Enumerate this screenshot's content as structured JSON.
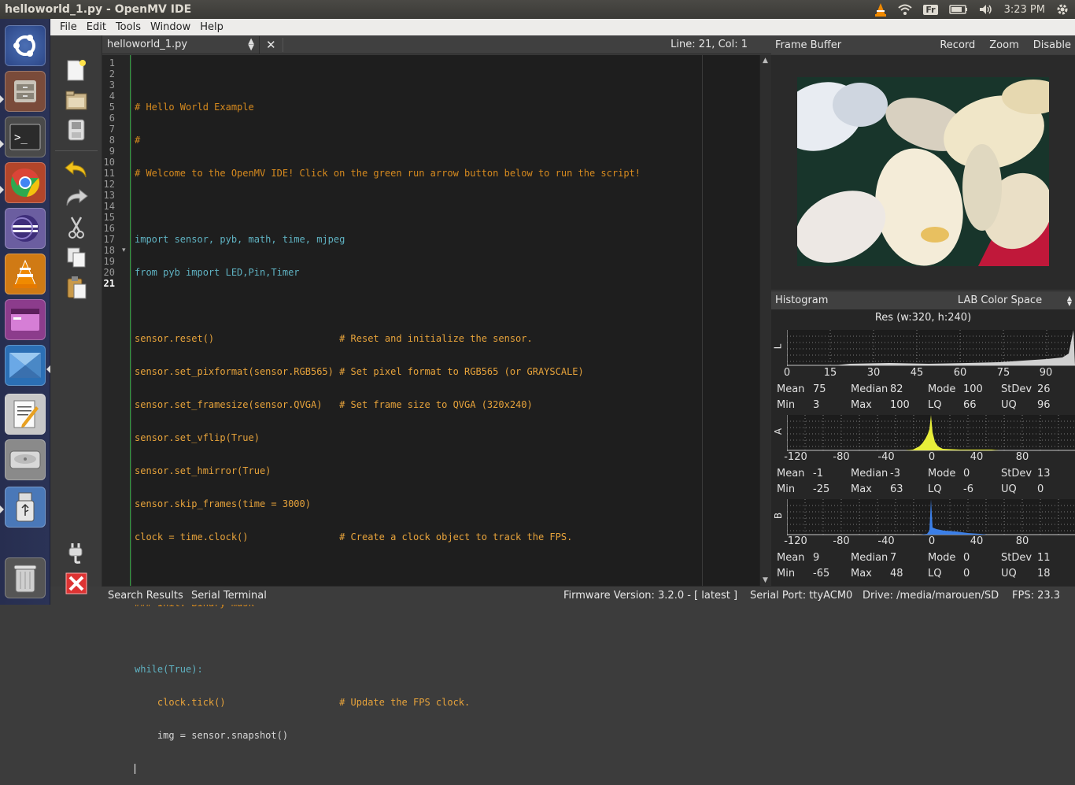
{
  "window": {
    "title": "helloworld_1.py - OpenMV IDE"
  },
  "tray": {
    "keyboard": "Fr",
    "clock": "3:23 PM"
  },
  "launcher": {
    "items": [
      "ubuntu-dash-icon",
      "file-cabinet-icon",
      "terminal-icon",
      "chrome-icon",
      "eclipse-icon",
      "vlc-icon",
      "window-app-icon",
      "openmv-icon",
      "text-editor-icon",
      "disk-drive-icon",
      "usb-drive-icon",
      "trash-icon"
    ]
  },
  "menubar": {
    "items": [
      "File",
      "Edit",
      "Tools",
      "Window",
      "Help"
    ]
  },
  "editor": {
    "filename": "helloworld_1.py",
    "lineinfo": "Line: 21, Col: 1",
    "line_numbers": [
      "1",
      "2",
      "3",
      "4",
      "5",
      "6",
      "7",
      "8",
      "9",
      "10",
      "11",
      "12",
      "13",
      "14",
      "15",
      "16",
      "17",
      "18",
      "19",
      "20",
      "21"
    ],
    "lines": [
      "# Hello World Example",
      "#",
      "# Welcome to the OpenMV IDE! Click on the green run arrow button below to run the script!",
      "",
      "import sensor, pyb, math, time, mjpeg",
      "from pyb import LED,Pin,Timer",
      "",
      "sensor.reset()                      # Reset and initialize the sensor.",
      "sensor.set_pixformat(sensor.RGB565) # Set pixel format to RGB565 (or GRAYSCALE)",
      "sensor.set_framesize(sensor.QVGA)   # Set frame size to QVGA (320x240)",
      "sensor.set_vflip(True)",
      "sensor.set_hmirror(True)",
      "sensor.skip_frames(time = 3000)",
      "clock = time.clock()                # Create a clock object to track the FPS.",
      "",
      "### Init: Binary mask",
      "",
      "while(True):",
      "    clock.tick()                    # Update the FPS clock.",
      "    img = sensor.snapshot()",
      ""
    ]
  },
  "framebuffer": {
    "title": "Frame Buffer",
    "record": "Record",
    "zoom": "Zoom",
    "disable": "Disable"
  },
  "histogram": {
    "title": "Histogram",
    "colorspace": "LAB Color Space",
    "resolution": "Res (w:320, h:240)",
    "channels": [
      {
        "label": "L",
        "color": "#cfcfcf",
        "axis": [
          "0",
          "15",
          "30",
          "45",
          "60",
          "75",
          "90"
        ],
        "mean_label": "Mean",
        "mean": "75",
        "median_label": "Median",
        "median": "82",
        "mode_label": "Mode",
        "mode": "100",
        "stdev_label": "StDev",
        "stdev": "26",
        "min_label": "Min",
        "min": "3",
        "max_label": "Max",
        "max": "100",
        "lq_label": "LQ",
        "lq": "66",
        "uq_label": "UQ",
        "uq": "96"
      },
      {
        "label": "A",
        "color": "#e8ee3a",
        "axis": [
          "-120",
          "-80",
          "-40",
          "0",
          "40",
          "80"
        ],
        "mean_label": "Mean",
        "mean": "-1",
        "median_label": "Median",
        "median": "-3",
        "mode_label": "Mode",
        "mode": "0",
        "stdev_label": "StDev",
        "stdev": "13",
        "min_label": "Min",
        "min": "-25",
        "max_label": "Max",
        "max": "63",
        "lq_label": "LQ",
        "lq": "-6",
        "uq_label": "UQ",
        "uq": "0"
      },
      {
        "label": "B",
        "color": "#3b7fe8",
        "axis": [
          "-120",
          "-80",
          "-40",
          "0",
          "40",
          "80"
        ],
        "mean_label": "Mean",
        "mean": "9",
        "median_label": "Median",
        "median": "7",
        "mode_label": "Mode",
        "mode": "0",
        "stdev_label": "StDev",
        "stdev": "11",
        "min_label": "Min",
        "min": "-65",
        "max_label": "Max",
        "max": "48",
        "lq_label": "LQ",
        "lq": "0",
        "uq_label": "UQ",
        "uq": "18"
      }
    ]
  },
  "statusbar": {
    "search_results": "Search Results",
    "serial_terminal": "Serial Terminal",
    "firmware": "Firmware Version: 3.2.0 - [ latest ]",
    "serial_port": "Serial Port: ttyACM0",
    "drive": "Drive: /media/marouen/SD",
    "fps": "FPS:  23.3"
  }
}
